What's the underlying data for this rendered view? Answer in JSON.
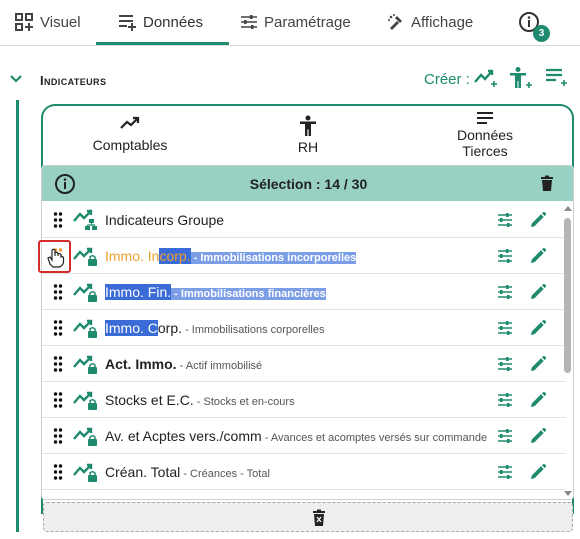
{
  "tabs": [
    {
      "label": "Visuel",
      "icon": "grid-add-icon"
    },
    {
      "label": "Données",
      "icon": "list-add-icon"
    },
    {
      "label": "Paramétrage",
      "icon": "sliders-icon"
    },
    {
      "label": "Affichage",
      "icon": "paint-icon"
    },
    {
      "label": "",
      "icon": "info-icon"
    }
  ],
  "badge_count": "3",
  "section": {
    "title": "Indicateurs",
    "create_label": "Créer :"
  },
  "categories": [
    {
      "label": "Comptables",
      "icon": "trend-icon"
    },
    {
      "label": "RH",
      "icon": "person-icon"
    },
    {
      "label": "Données Tierces",
      "icon": "list-icon"
    }
  ],
  "selection": {
    "title": "Sélection : 14 / 30"
  },
  "rows": [
    {
      "pre": "",
      "hl": "Indicateurs Groupe",
      "post": "",
      "desc": "",
      "style": "group"
    },
    {
      "pre": "Immo. In",
      "hl": "corp.",
      "post": "",
      "desc": "Immobilisations incorporelles",
      "style": "orange"
    },
    {
      "pre": "",
      "hl": "Immo. Fin.",
      "post": "",
      "desc": "Immobilisations financières",
      "style": "selected"
    },
    {
      "pre": "",
      "hl": "Immo. C",
      "post": "orp.",
      "desc": "Immobilisations corporelles",
      "style": "partial"
    },
    {
      "pre": "",
      "hl": "",
      "post": "Act. Immo.",
      "desc": "Actif immobilisé",
      "style": "bold"
    },
    {
      "pre": "",
      "hl": "",
      "post": "Stocks et E.C.",
      "desc": "Stocks et en-cours",
      "style": "normal"
    },
    {
      "pre": "",
      "hl": "",
      "post": "Av. et Acptes vers./comm",
      "desc": "Avances et acomptes versés sur commande",
      "style": "normal"
    },
    {
      "pre": "",
      "hl": "",
      "post": "Créan. Total",
      "desc": "Créances - Total",
      "style": "normal"
    }
  ],
  "colors": {
    "accent": "#1e8a6e",
    "header_bg": "#98d1c4",
    "highlight": "#3a6bd6",
    "orange": "#f0a030"
  }
}
